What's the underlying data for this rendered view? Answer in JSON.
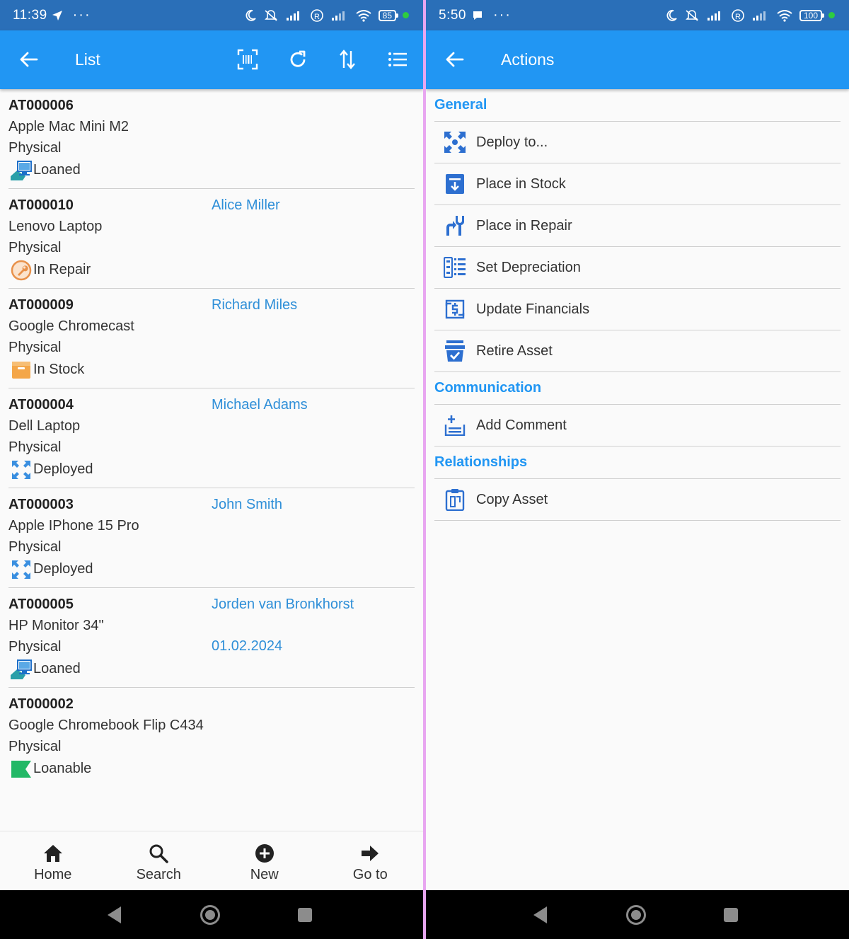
{
  "left": {
    "statusbar": {
      "time": "11:39",
      "dots": "···",
      "battery": "85"
    },
    "appbar": {
      "title": "List"
    },
    "items": [
      {
        "id": "AT000006",
        "name": "Apple Mac Mini M2",
        "type": "Physical",
        "status": "Loaned",
        "status_icon": "loaned-icon",
        "person": "",
        "date": ""
      },
      {
        "id": "AT000010",
        "name": "Lenovo Laptop",
        "type": "Physical",
        "status": "In Repair",
        "status_icon": "repair-icon",
        "person": "Alice Miller",
        "date": ""
      },
      {
        "id": "AT000009",
        "name": "Google Chromecast",
        "type": "Physical",
        "status": "In Stock",
        "status_icon": "stock-icon",
        "person": "Richard Miles",
        "date": ""
      },
      {
        "id": "AT000004",
        "name": "Dell Laptop",
        "type": "Physical",
        "status": "Deployed",
        "status_icon": "deployed-icon",
        "person": "Michael Adams",
        "date": ""
      },
      {
        "id": "AT000003",
        "name": "Apple IPhone 15 Pro",
        "type": "Physical",
        "status": "Deployed",
        "status_icon": "deployed-icon",
        "person": "John Smith",
        "date": ""
      },
      {
        "id": "AT000005",
        "name": "HP Monitor 34\"",
        "type": "Physical",
        "status": "Loaned",
        "status_icon": "loaned-icon",
        "person": "Jorden van Bronkhorst",
        "date": "01.02.2024"
      },
      {
        "id": "AT000002",
        "name": "Google Chromebook Flip C434",
        "type": "Physical",
        "status": "Loanable",
        "status_icon": "loanable-icon",
        "person": "",
        "date": ""
      }
    ],
    "bottomnav": [
      {
        "label": "Home",
        "icon": "home-icon"
      },
      {
        "label": "Search",
        "icon": "search-icon"
      },
      {
        "label": "New",
        "icon": "add-icon"
      },
      {
        "label": "Go to",
        "icon": "arrow-right-icon"
      }
    ]
  },
  "right": {
    "statusbar": {
      "time": "5:50",
      "dots": "···",
      "battery": "100"
    },
    "appbar": {
      "title": "Actions"
    },
    "sections": [
      {
        "title": "General",
        "actions": [
          {
            "label": "Deploy to...",
            "icon": "deploy-icon"
          },
          {
            "label": "Place in Stock",
            "icon": "stock-icon"
          },
          {
            "label": "Place in Repair",
            "icon": "repair-icon"
          },
          {
            "label": "Set Depreciation",
            "icon": "depreciation-icon"
          },
          {
            "label": "Update Financials",
            "icon": "financials-icon"
          },
          {
            "label": "Retire Asset",
            "icon": "retire-icon"
          }
        ]
      },
      {
        "title": "Communication",
        "actions": [
          {
            "label": "Add Comment",
            "icon": "comment-icon"
          }
        ]
      },
      {
        "title": "Relationships",
        "actions": [
          {
            "label": "Copy Asset",
            "icon": "copy-icon"
          }
        ]
      }
    ]
  },
  "colors": {
    "appbar": "#2196f3",
    "statusbar": "#2a6fb8",
    "link": "#2f8fd8",
    "divider": "#e8a6f0"
  }
}
